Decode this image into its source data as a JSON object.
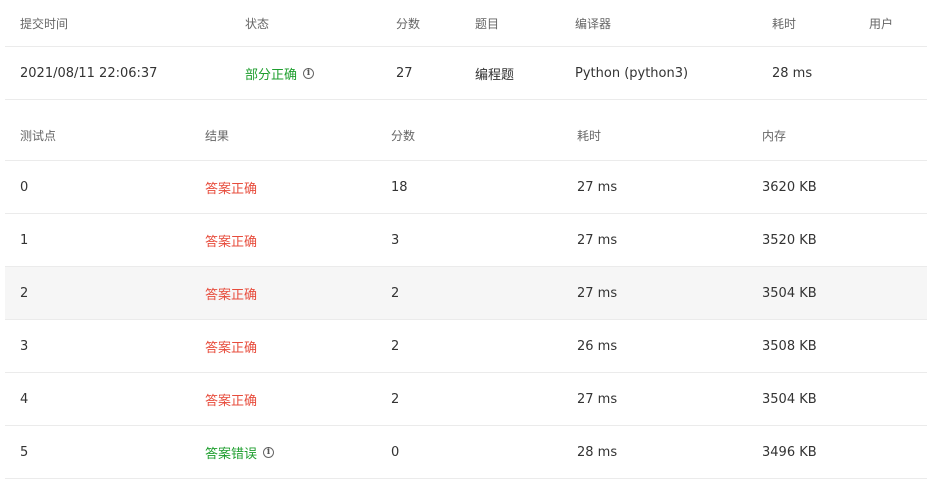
{
  "submission": {
    "headers": [
      "提交时间",
      "状态",
      "分数",
      "题目",
      "编译器",
      "耗时",
      "用户"
    ],
    "row": {
      "time": "2021/08/11 22:06:37",
      "status": "部分正确",
      "score": "27",
      "problem": "编程题",
      "compiler": "Python (python3)",
      "duration": "28 ms",
      "user": ""
    }
  },
  "tests": {
    "headers": [
      "测试点",
      "结果",
      "分数",
      "耗时",
      "内存"
    ],
    "rows": [
      {
        "id": "0",
        "result": "答案正确",
        "score": "18",
        "time": "27 ms",
        "memory": "3620 KB"
      },
      {
        "id": "1",
        "result": "答案正确",
        "score": "3",
        "time": "27 ms",
        "memory": "3520 KB"
      },
      {
        "id": "2",
        "result": "答案正确",
        "score": "2",
        "time": "27 ms",
        "memory": "3504 KB"
      },
      {
        "id": "3",
        "result": "答案正确",
        "score": "2",
        "time": "26 ms",
        "memory": "3508 KB"
      },
      {
        "id": "4",
        "result": "答案正确",
        "score": "2",
        "time": "27 ms",
        "memory": "3504 KB"
      },
      {
        "id": "5",
        "result": "答案错误",
        "score": "0",
        "time": "28 ms",
        "memory": "3496 KB"
      }
    ]
  },
  "icons": {
    "info": "i"
  },
  "colors": {
    "correct": "#e74c3c",
    "partial": "#1e9e2e",
    "wrong": "#1e9e2e"
  }
}
